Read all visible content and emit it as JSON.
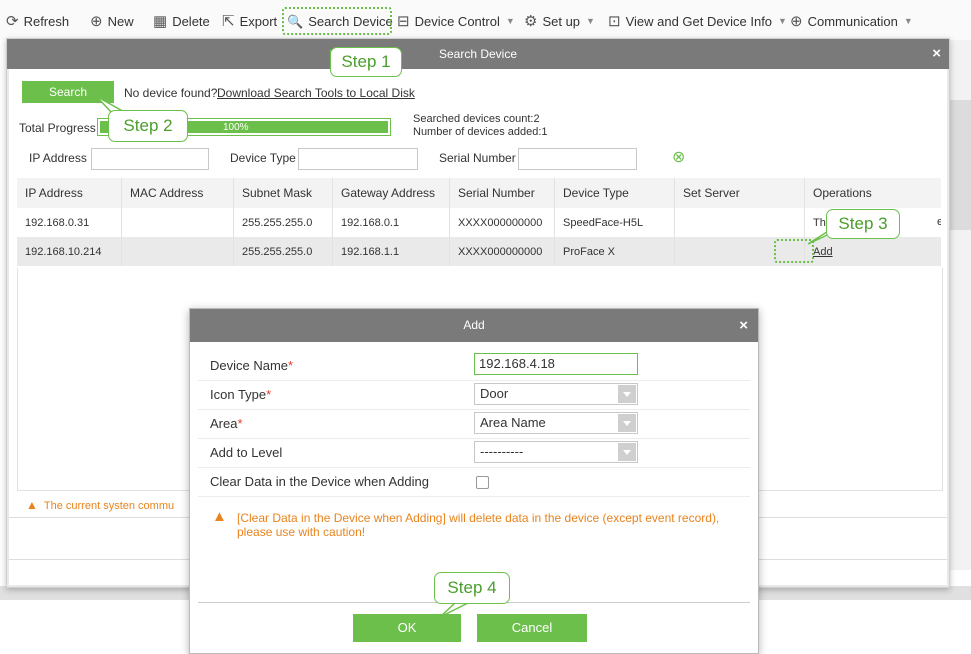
{
  "toolbar": {
    "items": [
      {
        "label": "Refresh",
        "icon": "refresh-icon",
        "glyph": "⟳"
      },
      {
        "label": "New",
        "icon": "new-icon",
        "glyph": "⊕"
      },
      {
        "label": "Delete",
        "icon": "delete-icon",
        "glyph": "▦"
      },
      {
        "label": "Export",
        "icon": "export-icon",
        "glyph": "⇱"
      },
      {
        "label": "Search Device",
        "icon": "search-icon",
        "glyph": "🔍"
      },
      {
        "label": "Device Control",
        "icon": "device-control-icon",
        "glyph": "⊟"
      },
      {
        "label": "Set up",
        "icon": "setup-gear-icon",
        "glyph": "⚙"
      },
      {
        "label": "View and Get Device Info",
        "icon": "view-info-icon",
        "glyph": "⊡"
      },
      {
        "label": "Communication",
        "icon": "communication-globe-icon",
        "glyph": "⊕"
      }
    ]
  },
  "search_dialog": {
    "title": "Search Device",
    "close_glyph": "×",
    "search_button": "Search",
    "no_device_text": "No device found?",
    "download_link": "Download Search Tools to Local Disk",
    "progress_label": "Total Progress",
    "progress_text": "100%",
    "progress_value": 1.0,
    "searched_count": "Searched devices count:2",
    "added_count": "Number of devices added:1",
    "filters": {
      "ip_label": "IP Address",
      "type_label": "Device Type",
      "serial_label": "Serial Number",
      "clear_glyph": "⊗"
    },
    "columns": [
      "IP Address",
      "MAC Address",
      "Subnet Mask",
      "Gateway Address",
      "Serial Number",
      "Device Type",
      "Set Server",
      "Operations"
    ],
    "rows": [
      [
        "192.168.0.31",
        "",
        "255.255.255.0",
        "192.168.0.1",
        "XXXX000000000",
        "SpeedFace-H5L",
        "",
        "This devi"
      ],
      [
        "192.168.10.214",
        "",
        "255.255.255.0",
        "192.168.1.1",
        "XXXX000000000",
        "ProFace X",
        "",
        "Add"
      ]
    ],
    "row1_op_tail": "ed",
    "warning_text": "The current systen commu"
  },
  "add_dialog": {
    "title": "Add",
    "close_glyph": "×",
    "fields": {
      "device_name_label": "Device Name",
      "device_name_value": "192.168.4.18",
      "icon_type_label": "Icon Type",
      "icon_type_value": "Door",
      "area_label": "Area",
      "area_value": "Area Name",
      "level_label": "Add to Level",
      "level_value": "----------",
      "clear_label": "Clear Data in the Device when Adding",
      "clear_checked": false
    },
    "required_mark": "*",
    "warning": "[Clear Data in the Device when Adding] will delete data in the device (except event record), please use with caution!",
    "ok_button": "OK",
    "cancel_button": "Cancel"
  },
  "callouts": {
    "step1": "Step 1",
    "step2": "Step 2",
    "step3": "Step 3",
    "step4": "Step 4"
  },
  "colors": {
    "accent_green": "#6cbf4b",
    "warning_orange": "#e8831e",
    "title_gray": "#7a7a7a"
  }
}
